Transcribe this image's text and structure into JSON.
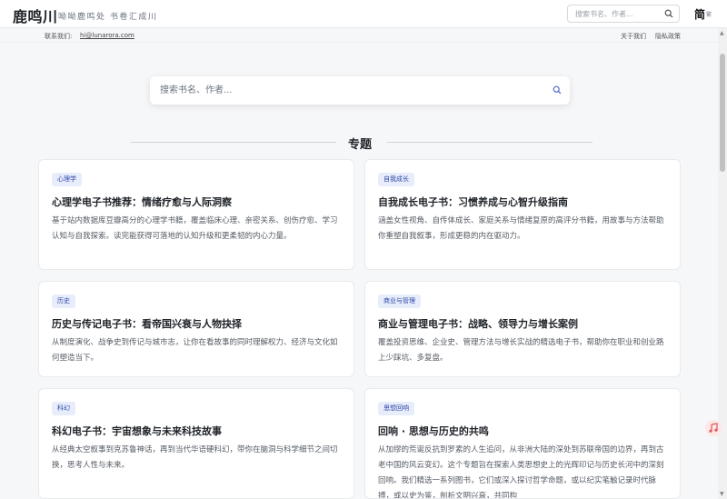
{
  "header": {
    "brand": "鹿鸣川",
    "tagline": "呦呦鹿鸣处 书卷汇成川",
    "search_placeholder": "搜索书名、作者...",
    "lang_label": "简",
    "lang_sub": "繁"
  },
  "subbar": {
    "contact_label": "联系我们:",
    "contact_email": "hi@lunarora.com",
    "about_label": "关于我们",
    "privacy_label": "隐私政策"
  },
  "main": {
    "search_placeholder": "搜索书名、作者...",
    "section_title": "专题"
  },
  "cards": [
    {
      "tag": "心理学",
      "title": "心理学电子书推荐：情绪疗愈与人际洞察",
      "desc": "基于站内数据库豆瓣高分的心理学书籍，覆盖临床心理、亲密关系、创伤疗愈、学习认知与自我探索。读完能获得可落地的认知升级和更柔韧的内心力量。"
    },
    {
      "tag": "自我成长",
      "title": "自我成长电子书：习惯养成与心智升级指南",
      "desc": "涵盖女性视角、自传体成长、家庭关系与情绪复原的高评分书籍，用故事与方法帮助你重塑自我叙事，形成更稳的内在驱动力。"
    },
    {
      "tag": "历史",
      "title": "历史与传记电子书：看帝国兴衰与人物抉择",
      "desc": "从制度演化、战争史到传记与城市志，让你在看故事的同时理解权力、经济与文化如何塑造当下。"
    },
    {
      "tag": "商业与管理",
      "title": "商业与管理电子书：战略、领导力与增长案例",
      "desc": "覆盖投资思维、企业史、管理方法与增长实战的精选电子书，帮助你在职业和创业路上少踩坑、多复盘。"
    },
    {
      "tag": "科幻",
      "title": "科幻电子书：宇宙想象与未来科技故事",
      "desc": "从经典太空叙事到克苏鲁神话，再到当代华语硬科幻，带你在脑洞与科学细节之间切换，思考人性与未来。"
    },
    {
      "tag": "思想回响",
      "title": "回响 · 思想与历史的共鸣",
      "desc": "从加缪的荒诞反抗到罗素的人生追问，从非洲大陆的深处到苏联帝国的边界，再到古老中国的风云变幻。这个专题旨在探索人类思想史上的光辉印记与历史长河中的深刻回响。我们精选一系列图书，它们或深入探讨哲学命题，或以纪实笔触记录时代脉搏，或以史为鉴，剖析文明兴衰，共同构"
    }
  ],
  "colors": {
    "badge_bg": "#e8edfb",
    "badge_text": "#2f47a8",
    "page_bg": "#f6f7f9"
  },
  "icons": {
    "search": "search-icon",
    "fab": "music-note-icon"
  }
}
